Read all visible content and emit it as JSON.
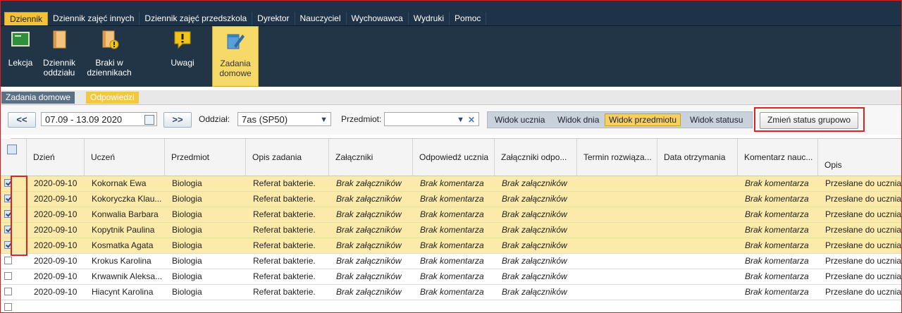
{
  "menu": {
    "tabs": [
      "Dziennik",
      "Dziennik zajęć innych",
      "Dziennik zajęć przedszkola",
      "Dyrektor",
      "Nauczyciel",
      "Wychowawca",
      "Wydruki",
      "Pomoc"
    ]
  },
  "ribbon": {
    "lekcja": "Lekcja",
    "dziennik_1": "Dziennik",
    "dziennik_2": "oddziału",
    "braki_1": "Braki w",
    "braki_2": "dziennikach",
    "uwagi": "Uwagi",
    "zadania_1": "Zadania",
    "zadania_2": "domowe"
  },
  "subtabs": {
    "active": "Zadania domowe",
    "other": "Odpowiedzi"
  },
  "toolbar": {
    "prev": "<<",
    "next": ">>",
    "date_range": "07.09 - 13.09 2020",
    "oddzial_label": "Oddział:",
    "oddzial_value": "7as (SP50)",
    "przedmiot_label": "Przedmiot:",
    "przedmiot_value": "",
    "views": [
      "Widok ucznia",
      "Widok dnia",
      "Widok przedmiotu",
      "Widok statusu"
    ],
    "selected_view": "Widok przedmiotu",
    "status_button": "Zmień status grupowo"
  },
  "grid": {
    "headers": [
      "Dzień",
      "Uczeń",
      "Przedmiot",
      "Opis zadania",
      "Załączniki",
      "Odpowiedź ucznia",
      "Załączniki odpo...",
      "Termin rozwiąza...",
      "Data otrzymania",
      "Komentarz nauc...",
      "Opis"
    ],
    "rows": [
      {
        "checked": true,
        "day": "2020-09-10",
        "student": "Kokornak Ewa",
        "subject": "Biologia",
        "desc": "Referat bakterie.",
        "att": "Brak załączników",
        "ans": "Brak komentarza",
        "ans_att": "Brak załączników",
        "due": "",
        "recv": "",
        "comment": "Brak komentarza",
        "status": "Przesłane do ucznia"
      },
      {
        "checked": true,
        "day": "2020-09-10",
        "student": "Kokoryczka Klau...",
        "subject": "Biologia",
        "desc": "Referat bakterie.",
        "att": "Brak załączników",
        "ans": "Brak komentarza",
        "ans_att": "Brak załączników",
        "due": "",
        "recv": "",
        "comment": "Brak komentarza",
        "status": "Przesłane do ucznia"
      },
      {
        "checked": true,
        "day": "2020-09-10",
        "student": "Konwalia Barbara",
        "subject": "Biologia",
        "desc": "Referat bakterie.",
        "att": "Brak załączników",
        "ans": "Brak komentarza",
        "ans_att": "Brak załączników",
        "due": "",
        "recv": "",
        "comment": "Brak komentarza",
        "status": "Przesłane do ucznia"
      },
      {
        "checked": true,
        "day": "2020-09-10",
        "student": "Kopytnik Paulina",
        "subject": "Biologia",
        "desc": "Referat bakterie.",
        "att": "Brak załączników",
        "ans": "Brak komentarza",
        "ans_att": "Brak załączników",
        "due": "",
        "recv": "",
        "comment": "Brak komentarza",
        "status": "Przesłane do ucznia"
      },
      {
        "checked": true,
        "day": "2020-09-10",
        "student": "Kosmatka Agata",
        "subject": "Biologia",
        "desc": "Referat bakterie.",
        "att": "Brak załączników",
        "ans": "Brak komentarza",
        "ans_att": "Brak załączników",
        "due": "",
        "recv": "",
        "comment": "Brak komentarza",
        "status": "Przesłane do ucznia"
      },
      {
        "checked": false,
        "day": "2020-09-10",
        "student": "Krokus Karolina",
        "subject": "Biologia",
        "desc": "Referat bakterie.",
        "att": "Brak załączników",
        "ans": "Brak komentarza",
        "ans_att": "Brak załączników",
        "due": "",
        "recv": "",
        "comment": "Brak komentarza",
        "status": "Przesłane do ucznia"
      },
      {
        "checked": false,
        "day": "2020-09-10",
        "student": "Krwawnik Aleksa...",
        "subject": "Biologia",
        "desc": "Referat bakterie.",
        "att": "Brak załączników",
        "ans": "Brak komentarza",
        "ans_att": "Brak załączników",
        "due": "",
        "recv": "",
        "comment": "Brak komentarza",
        "status": "Przesłane do ucznia"
      },
      {
        "checked": false,
        "day": "2020-09-10",
        "student": "Hiacynt Karolina",
        "subject": "Biologia",
        "desc": "Referat bakterie.",
        "att": "Brak załączników",
        "ans": "Brak komentarza",
        "ans_att": "Brak załączników",
        "due": "",
        "recv": "",
        "comment": "Brak komentarza",
        "status": "Przesłane do ucznia"
      }
    ]
  },
  "colors": {
    "menu_bg": "#1e3347",
    "accent": "#f2c23a",
    "selected_row": "#fbeaa9",
    "highlight": "#d62525"
  },
  "icons": {
    "lekcja": "lesson-screen-icon",
    "dziennik": "journal-icon",
    "braki": "warning-journal-icon",
    "uwagi": "exclamation-icon",
    "zadania": "homework-icon"
  }
}
